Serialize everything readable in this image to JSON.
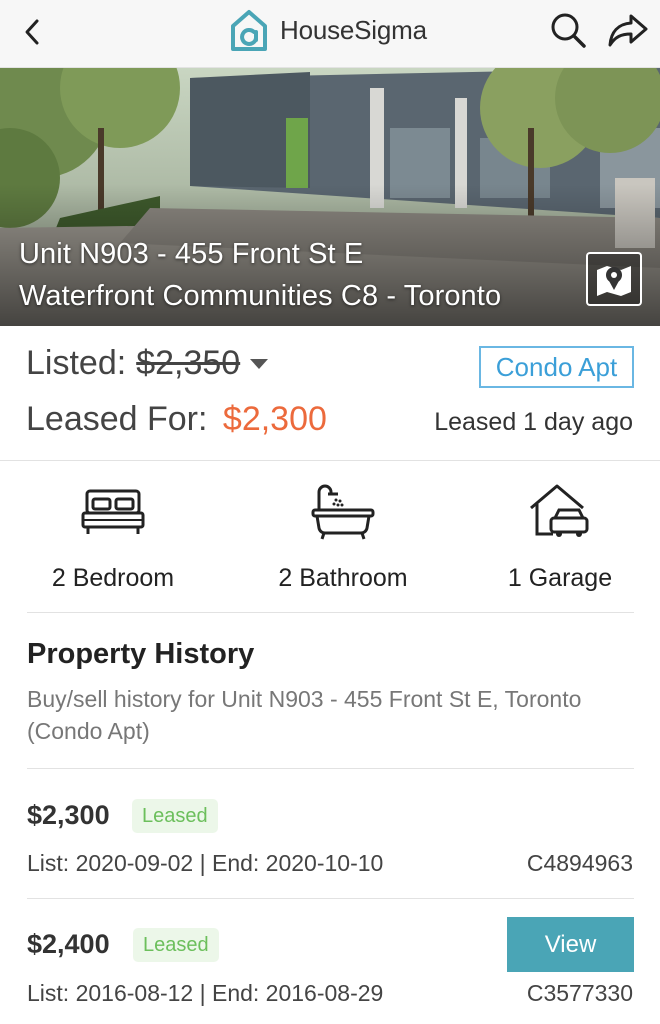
{
  "header": {
    "brand": "HouseSigma",
    "back_icon": "back-arrow-icon",
    "search_icon": "search-icon",
    "share_icon": "share-icon"
  },
  "hero": {
    "address_line1": "Unit N903 - 455 Front St E",
    "address_line2": "Waterfront Communities C8 - Toronto",
    "map_icon": "map-pin-icon"
  },
  "pricing": {
    "listed_label": "Listed:",
    "listed_value": "$2,350",
    "leased_label": "Leased For:",
    "leased_value": "$2,300",
    "leased_ago": "Leased 1 day ago",
    "property_type": "Condo Apt",
    "accent_color": "#ec6a3c"
  },
  "features": [
    {
      "icon": "bed-icon",
      "label": "2 Bedroom"
    },
    {
      "icon": "bathtub-icon",
      "label": "2 Bathroom"
    },
    {
      "icon": "garage-icon",
      "label": "1 Garage"
    }
  ],
  "history": {
    "title": "Property History",
    "subtitle": "Buy/sell history for Unit N903 - 455 Front St E, Toronto (Condo Apt)",
    "records": [
      {
        "price": "$2,300",
        "status": "Leased",
        "dates": "List: 2020-09-02 | End: 2020-10-10",
        "mls": "C4894963"
      },
      {
        "price": "$2,400",
        "status": "Leased",
        "dates": "List: 2016-08-12 | End: 2016-08-29",
        "mls": "C3577330",
        "button": "View"
      }
    ]
  }
}
